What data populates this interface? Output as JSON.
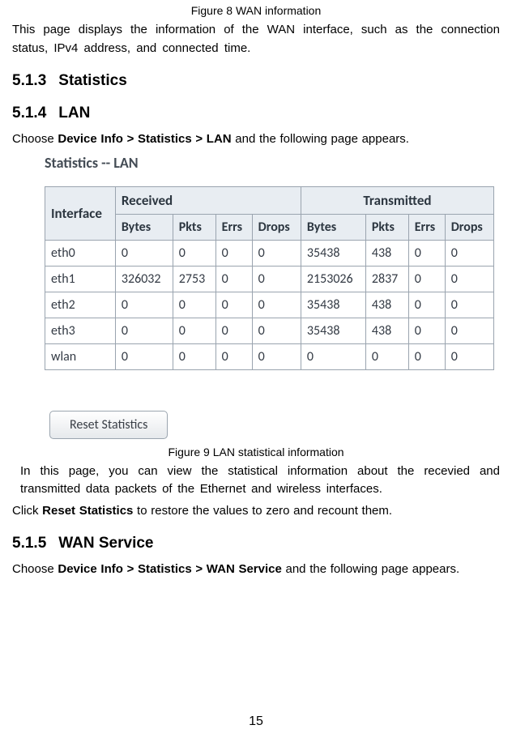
{
  "fig8_caption": "Figure 8 WAN information",
  "para1": "This page displays the information of the WAN interface, such as the connection status, IPv4 address, and connected time.",
  "h_513_num": "5.1.3",
  "h_513_text": "Statistics",
  "h_514_num": "5.1.4",
  "h_514_text": "LAN",
  "para2_pre": "Choose ",
  "para2_bold": "Device Info > Statistics > LAN",
  "para2_post": " and the following page appears.",
  "stats_title": "Statistics -- LAN",
  "thead1": {
    "iface": "Interface",
    "rx": "Received",
    "tx": "Transmitted"
  },
  "thead2": {
    "bytes": "Bytes",
    "pkts": "Pkts",
    "errs": "Errs",
    "drops": "Drops"
  },
  "chart_data": {
    "type": "table",
    "title": "Statistics -- LAN",
    "columns": [
      "Interface",
      "Received Bytes",
      "Received Pkts",
      "Received Errs",
      "Received Drops",
      "Transmitted Bytes",
      "Transmitted Pkts",
      "Transmitted Errs",
      "Transmitted Drops"
    ],
    "rows": [
      {
        "iface": "eth0",
        "rx_bytes": "0",
        "rx_pkts": "0",
        "rx_errs": "0",
        "rx_drops": "0",
        "tx_bytes": "35438",
        "tx_pkts": "438",
        "tx_errs": "0",
        "tx_drops": "0"
      },
      {
        "iface": "eth1",
        "rx_bytes": "326032",
        "rx_pkts": "2753",
        "rx_errs": "0",
        "rx_drops": "0",
        "tx_bytes": "2153026",
        "tx_pkts": "2837",
        "tx_errs": "0",
        "tx_drops": "0"
      },
      {
        "iface": "eth2",
        "rx_bytes": "0",
        "rx_pkts": "0",
        "rx_errs": "0",
        "rx_drops": "0",
        "tx_bytes": "35438",
        "tx_pkts": "438",
        "tx_errs": "0",
        "tx_drops": "0"
      },
      {
        "iface": "eth3",
        "rx_bytes": "0",
        "rx_pkts": "0",
        "rx_errs": "0",
        "rx_drops": "0",
        "tx_bytes": "35438",
        "tx_pkts": "438",
        "tx_errs": "0",
        "tx_drops": "0"
      },
      {
        "iface": "wlan",
        "rx_bytes": "0",
        "rx_pkts": "0",
        "rx_errs": "0",
        "rx_drops": "0",
        "tx_bytes": "0",
        "tx_pkts": "0",
        "tx_errs": "0",
        "tx_drops": "0"
      }
    ]
  },
  "reset_btn": "Reset Statistics",
  "fig9_caption": "Figure 9 LAN statistical information",
  "para3": "In this page, you can view the statistical information about the recevied and transmitted data packets of the Ethernet and wireless interfaces.",
  "para4_pre": "Click ",
  "para4_bold": "Reset Statistics",
  "para4_post": " to restore the values to zero and recount them.",
  "h_515_num": "5.1.5",
  "h_515_text": "WAN Service",
  "para5_pre": "Choose ",
  "para5_bold": "Device Info > Statistics > WAN Service",
  "para5_post": " and the following page appears.",
  "page_number": "15"
}
